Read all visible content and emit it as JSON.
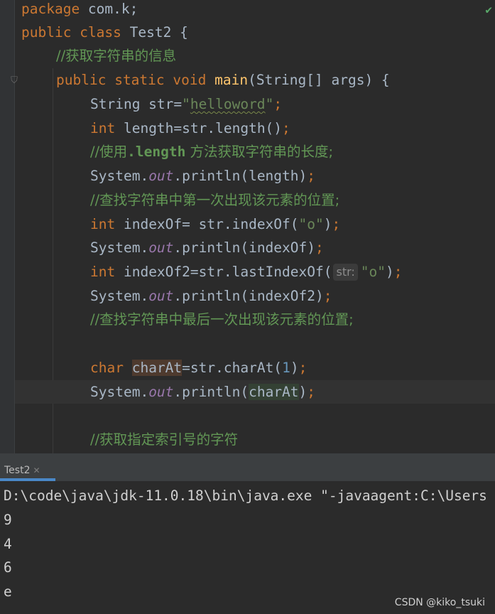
{
  "editor": {
    "lines": {
      "l1_kw": "package",
      "l1_rest": " com.k;",
      "l2_kw1": "public",
      "l2_kw2": "class",
      "l2_rest": " Test2 {",
      "l3_cmt": "//获取字符串的信息",
      "l4_kw1": "public",
      "l4_kw2": "static",
      "l4_kw3": "void",
      "l4_fn": "main",
      "l4_rest": "(String[] args) {",
      "l5_a": "String str=",
      "l5_q1": "\"",
      "l5_str": "helloword",
      "l5_q2": "\"",
      "l5_end": ";",
      "l6_kw": "int",
      "l6_rest": " length=str.length()",
      "l6_end": ";",
      "l7_c1": "//使用",
      "l7_c2": ".length",
      "l7_c3": " 方法获取字符串的长度;",
      "l8_a": "System.",
      "l8_f": "out",
      "l8_b": ".println(length)",
      "l8_end": ";",
      "l9_cmt": "//查找字符串中第一次出现该元素的位置;",
      "l10_kw": "int",
      "l10_a": " indexOf= str.indexOf(",
      "l10_str": "\"o\"",
      "l10_b": ")",
      "l10_end": ";",
      "l11_a": "System.",
      "l11_f": "out",
      "l11_b": ".println(indexOf)",
      "l11_end": ";",
      "l12_kw": "int",
      "l12_a": " indexOf2=str.lastIndexOf(",
      "l12_hint": "str:",
      "l12_str": "\"o\"",
      "l12_b": ")",
      "l12_end": ";",
      "l13_a": "System.",
      "l13_f": "out",
      "l13_b": ".println(indexOf2)",
      "l13_end": ";",
      "l14_cmt": "//查找字符串中最后一次出现该元素的位置;",
      "l16_kw": "char",
      "l16_var": "charAt",
      "l16_a": "=str.charAt(",
      "l16_num": "1",
      "l16_b": ")",
      "l16_end": ";",
      "l17_a": "System.",
      "l17_f": "out",
      "l17_b": ".println(",
      "l17_var": "charAt",
      "l17_c": ")",
      "l17_end": ";",
      "l19_cmt": "//获取指定索引号的字符"
    },
    "icons": {
      "check": "check-icon",
      "fold": "fold-marker-icon"
    }
  },
  "run": {
    "tab_label": "Test2",
    "command": "D:\\code\\java\\jdk-11.0.18\\bin\\java.exe \"-javaagent:C:\\Users",
    "output": [
      "9",
      "4",
      "6",
      "e"
    ]
  },
  "watermark": "CSDN @kiko_tsuki",
  "colors": {
    "keyword": "#cc7832",
    "string": "#6a8759",
    "comment": "#629755",
    "function": "#ffc66d",
    "static_field": "#9876aa",
    "number": "#6897bb",
    "text": "#a9b7c6",
    "background": "#2b2b2b"
  }
}
